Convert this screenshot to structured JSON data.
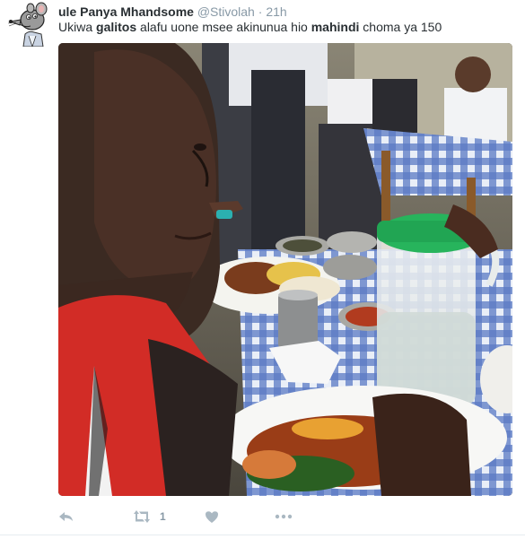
{
  "tweet": {
    "author_name": "ule Panya Mhandsome",
    "author_handle": "@Stivolah",
    "separator": "·",
    "timestamp": "21h",
    "text_parts": [
      "Ukiwa ",
      "galitos",
      " alafu uone msee akinunua hio ",
      "mahindi",
      " choma ya 150"
    ],
    "actions": {
      "reply_icon": "reply-icon",
      "retweet_icon": "retweet-icon",
      "retweet_count": "1",
      "like_icon": "heart-icon",
      "more_icon": "more-icon"
    }
  },
  "colors": {
    "name": "#292f33",
    "meta": "#8899a6",
    "action_icon": "#aab8c2",
    "jug_lid": "#25b35a",
    "tablecloth": "#3c5fb6"
  }
}
